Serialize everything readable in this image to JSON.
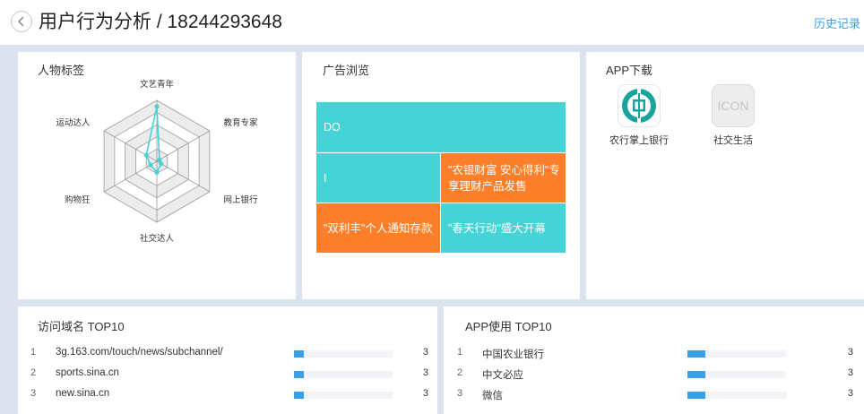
{
  "header": {
    "title": "用户行为分析 / 18244293648",
    "history_label": "历史记录"
  },
  "tags_panel": {
    "title": "人物标签",
    "axes": [
      {
        "label": "文艺青年",
        "value": 0.9
      },
      {
        "label": "教育专家",
        "value": 0.05
      },
      {
        "label": "网上银行",
        "value": 0.08
      },
      {
        "label": "社交达人",
        "value": 0.18
      },
      {
        "label": "购物狂",
        "value": 0.12
      },
      {
        "label": "运动达人",
        "value": 0.2
      }
    ],
    "line_color": "#45d3d6",
    "ring_colors": [
      "#ececec",
      "#ffffff"
    ]
  },
  "ads_panel": {
    "title": "广告浏览",
    "cells": [
      {
        "label": "DO",
        "color": "#45d3d6"
      },
      {
        "label": "I",
        "color": "#45d3d6"
      },
      {
        "label": "\"农银财富 安心得利\"专享理财产品发售",
        "color": "#fd7f2a"
      },
      {
        "label": "\"双利丰\"个人通知存款",
        "color": "#fd7f2a"
      },
      {
        "label": "\"春天行动\"盛大开幕",
        "color": "#45d3d6"
      }
    ]
  },
  "apps_panel": {
    "title": "APP下载",
    "apps": [
      {
        "name": "农行掌上银行",
        "icon": "abc-bank-logo-icon"
      },
      {
        "name": "社交生活",
        "icon": "placeholder-icon",
        "icon_text": "ICON"
      }
    ]
  },
  "domains_panel": {
    "title": "访问域名 TOP10",
    "rows": [
      {
        "rank": "1",
        "name": "3g.163.com/touch/news/subchannel/",
        "value": "3",
        "fraction": 0.1
      },
      {
        "rank": "2",
        "name": "sports.sina.cn",
        "value": "3",
        "fraction": 0.1
      },
      {
        "rank": "3",
        "name": "new.sina.cn",
        "value": "3",
        "fraction": 0.1
      }
    ]
  },
  "appuse_panel": {
    "title": "APP使用 TOP10",
    "rows": [
      {
        "rank": "1",
        "name": "中国农业银行",
        "value": "3",
        "fraction": 0.18
      },
      {
        "rank": "2",
        "name": "中文必应",
        "value": "3",
        "fraction": 0.18
      },
      {
        "rank": "3",
        "name": "微信",
        "value": "3",
        "fraction": 0.18
      }
    ]
  },
  "colors": {
    "accent": "#3aa0e6",
    "teal": "#45d3d6",
    "orange": "#fd7f2a",
    "background": "#dde3ee"
  }
}
